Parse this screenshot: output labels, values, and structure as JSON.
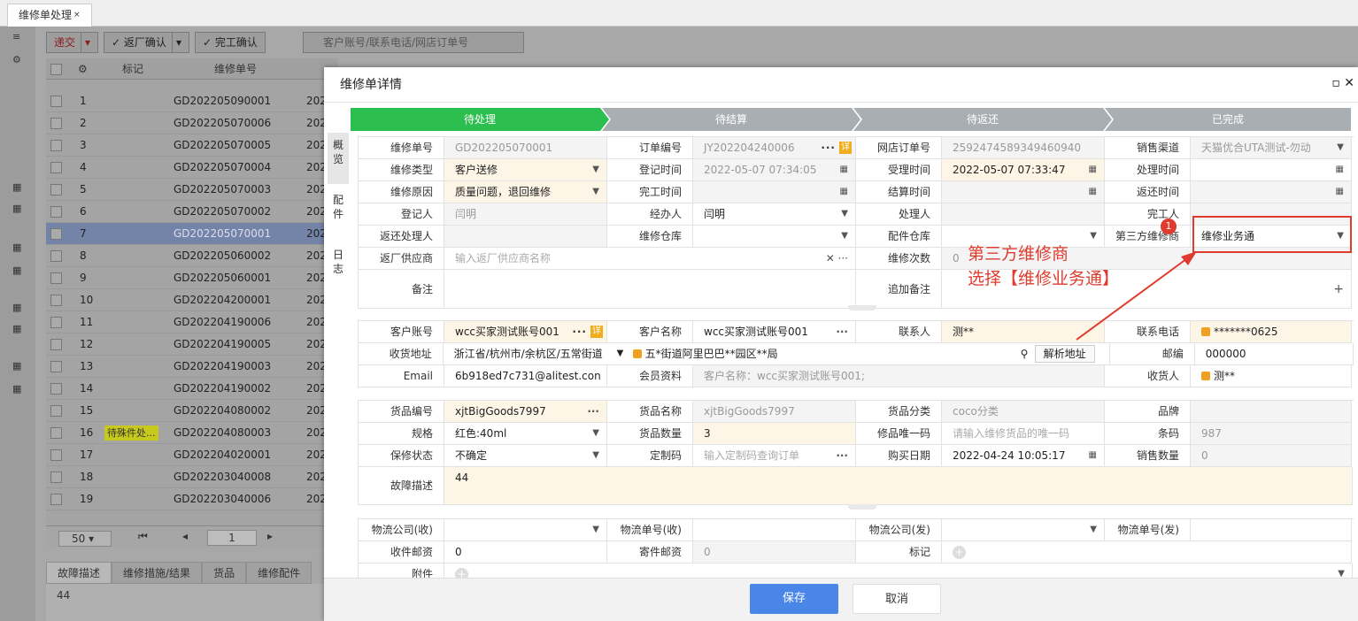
{
  "tabbar": {
    "tab": "维修单处理",
    "close": "×"
  },
  "toolbar": {
    "submit": "递交",
    "return_confirm": "返厂确认",
    "finish_confirm": "完工确认",
    "search_placeholder": "客户账号/联系电话/网店订单号"
  },
  "grid": {
    "headers": [
      "标记",
      "维修单号"
    ],
    "rows": [
      {
        "no": "1",
        "id": "GD202205090001",
        "y": "202"
      },
      {
        "no": "2",
        "id": "GD202205070006",
        "y": "202"
      },
      {
        "no": "3",
        "id": "GD202205070005",
        "y": "202"
      },
      {
        "no": "4",
        "id": "GD202205070004",
        "y": "202"
      },
      {
        "no": "5",
        "id": "GD202205070003",
        "y": "202"
      },
      {
        "no": "6",
        "id": "GD202205070002",
        "y": "202"
      },
      {
        "no": "7",
        "id": "GD202205070001",
        "y": "202"
      },
      {
        "no": "8",
        "id": "GD202205060002",
        "y": "202"
      },
      {
        "no": "9",
        "id": "GD202205060001",
        "y": "202"
      },
      {
        "no": "10",
        "id": "GD202204200001",
        "y": "202"
      },
      {
        "no": "11",
        "id": "GD202204190006",
        "y": "202"
      },
      {
        "no": "12",
        "id": "GD202204190005",
        "y": "202"
      },
      {
        "no": "13",
        "id": "GD202204190003",
        "y": "202"
      },
      {
        "no": "14",
        "id": "GD202204190002",
        "y": "202"
      },
      {
        "no": "15",
        "id": "GD202204080002",
        "y": "202"
      },
      {
        "no": "16",
        "id": "GD202204080003",
        "y": "202",
        "tag": "待殊件处..."
      },
      {
        "no": "17",
        "id": "GD202204020001",
        "y": "202"
      },
      {
        "no": "18",
        "id": "GD202203040008",
        "y": "202"
      },
      {
        "no": "19",
        "id": "GD202203040006",
        "y": "202"
      }
    ],
    "page_size": "50",
    "page": "1"
  },
  "bottom_tabs": [
    "故障描述",
    "维修措施/结果",
    "货品",
    "维修配件"
  ],
  "bottom_value": "44",
  "dialog": {
    "title": "维修单详情",
    "steps": [
      "待处理",
      "待结算",
      "待返还",
      "已完成"
    ],
    "side_tabs": [
      "概览",
      "配件",
      "日志"
    ],
    "f": {
      "l_wxdh": "维修单号",
      "v_wxdh": "GD202205070001",
      "l_ddbh": "订单编号",
      "v_ddbh": "JY202204240006",
      "l_wddd": "网店订单号",
      "v_wddd": "2592474589349460940",
      "l_xsqd": "销售渠道",
      "v_xsqd": "天猫优合UTA测试-勿动",
      "l_wxlx": "维修类型",
      "v_wxlx": "客户送修",
      "l_djsj": "登记时间",
      "v_djsj": "2022-05-07 07:34:05",
      "l_slsj": "受理时间",
      "v_slsj": "2022-05-07 07:33:47",
      "l_clsj": "处理时间",
      "l_wxyy": "维修原因",
      "v_wxyy": "质量问题，退回维修",
      "l_wgsj": "完工时间",
      "l_jssj": "结算时间",
      "l_fhsj": "返还时间",
      "l_djr": "登记人",
      "v_djr": "闫明",
      "l_jbr": "经办人",
      "v_jbr": "闫明",
      "l_clr": "处理人",
      "l_wgr": "完工人",
      "l_fhclr": "返还处理人",
      "l_wxck": "维修仓库",
      "l_pjck": "配件仓库",
      "l_dsf": "第三方维修商",
      "v_dsf": "维修业务通",
      "l_fcgys": "返厂供应商",
      "ph_fcgys": "输入返厂供应商名称",
      "l_wxcs": "维修次数",
      "v_wxcs": "0",
      "l_bz": "备注",
      "l_zjbz": "追加备注",
      "l_khzh": "客户账号",
      "v_khzh": "wcc买家测试账号001",
      "l_khmc": "客户名称",
      "v_khmc": "wcc买家测试账号001",
      "l_lxr": "联系人",
      "v_lxr": "测**",
      "l_lxdh": "联系电话",
      "v_lxdh": "*******0625",
      "l_shdz": "收货地址",
      "v_shdz": "浙江省/杭州市/余杭区/五常街道",
      "v_shdz2": "五*街道阿里巴巴**园区**局",
      "btn_jx": "解析地址",
      "l_yb": "邮编",
      "v_yb": "000000",
      "l_email": "Email",
      "v_email": "6b918ed7c731@alitest.con",
      "l_hyzl": "会员资料",
      "v_hyzl": "客户名称：wcc买家测试账号001;",
      "l_shr": "收货人",
      "v_shr": "测**",
      "l_hpbh": "货品编号",
      "v_hpbh": "xjtBigGoods7997",
      "l_hpmc": "货品名称",
      "v_hpmc": "xjtBigGoods7997",
      "l_hpfl": "货品分类",
      "v_hpfl": "coco分类",
      "l_pp": "品牌",
      "l_gg": "规格",
      "v_gg": "红色:40ml",
      "l_hpsl": "货品数量",
      "v_hpsl": "3",
      "l_xpwy": "修品唯一码",
      "ph_xpwy": "请输入维修货品的唯一码",
      "l_tm": "条码",
      "v_tm": "987",
      "l_bxzt": "保修状态",
      "v_bxzt": "不确定",
      "l_dzm": "定制码",
      "ph_dzm": "输入定制码查询订单",
      "l_gmrq": "购买日期",
      "v_gmrq": "2022-04-24 10:05:17",
      "l_xssl": "销售数量",
      "v_xssl": "0",
      "l_gzms": "故障描述",
      "v_gzms": "44",
      "l_wlgs_s": "物流公司(收)",
      "l_wldh_s": "物流单号(收)",
      "l_wlgs_f": "物流公司(发)",
      "l_wldh_f": "物流单号(发)",
      "l_sjyz": "收件邮资",
      "v_sjyz": "0",
      "l_jjyz": "寄件邮资",
      "v_jjyz": "0",
      "l_bj": "标记",
      "l_fj": "附件",
      "xiang": "详"
    },
    "save": "保存",
    "cancel": "取消"
  },
  "annotation": {
    "line1": "第三方维修商",
    "line2": "选择【维修业务通】",
    "badge": "1"
  },
  "colors": {
    "step_active": "#2cbe4e",
    "step_inactive": "#a9aeb3",
    "save": "#4a86e8",
    "annot": "#e03b2e"
  }
}
